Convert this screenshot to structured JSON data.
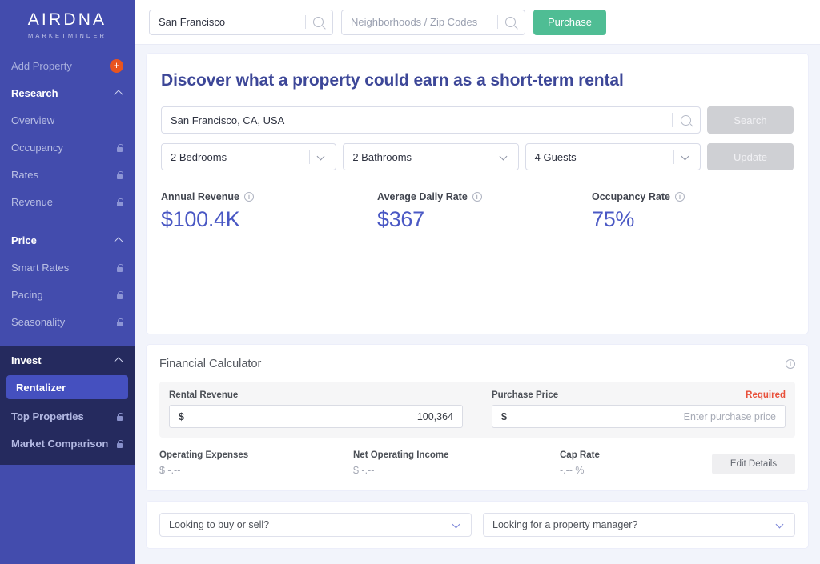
{
  "sidebar": {
    "logo_main": "AIRDNA",
    "logo_sub": "MARKETMINDER",
    "add_property": "Add Property",
    "plus": "+",
    "sections": {
      "research": "Research",
      "price": "Price",
      "invest": "Invest"
    },
    "research_items": [
      {
        "label": "Overview",
        "locked": false
      },
      {
        "label": "Occupancy",
        "locked": true
      },
      {
        "label": "Rates",
        "locked": true
      },
      {
        "label": "Revenue",
        "locked": true
      }
    ],
    "price_items": [
      {
        "label": "Smart Rates",
        "locked": true
      },
      {
        "label": "Pacing",
        "locked": true
      },
      {
        "label": "Seasonality",
        "locked": true
      }
    ],
    "invest_items": [
      {
        "label": "Rentalizer",
        "locked": false,
        "active": true
      },
      {
        "label": "Top Properties",
        "locked": true
      },
      {
        "label": "Market Comparison",
        "locked": true
      }
    ],
    "colors": {
      "background": "#434cad",
      "invest_panel": "#252a5e",
      "active_item": "#4550bf",
      "add_property_button": "#e8541f"
    }
  },
  "topbar": {
    "city_value": "San Francisco",
    "neighborhood_placeholder": "Neighborhoods / Zip Codes",
    "purchase_label": "Purchase",
    "purchase_color": "#4fbd94",
    "search_icon": "search-icon"
  },
  "hero": {
    "title": "Discover what a property could earn as a short-term rental",
    "location_value": "San Francisco, CA, USA",
    "search_label": "Search",
    "update_label": "Update",
    "bedrooms": "2 Bedrooms",
    "bathrooms": "2 Bathrooms",
    "guests": "4 Guests",
    "metrics": [
      {
        "label": "Annual Revenue",
        "value": "$100.4K"
      },
      {
        "label": "Average Daily Rate",
        "value": "$367"
      },
      {
        "label": "Occupancy Rate",
        "value": "75%"
      }
    ],
    "metric_color": "#4a58c4",
    "title_color": "#3d4798"
  },
  "calculator": {
    "title": "Financial Calculator",
    "rental_revenue_label": "Rental Revenue",
    "rental_revenue_value": "100,364",
    "purchase_price_label": "Purchase Price",
    "purchase_price_placeholder": "Enter purchase price",
    "required_label": "Required",
    "required_color": "#e8503a",
    "currency_symbol": "$",
    "stats": [
      {
        "label": "Operating Expenses",
        "value": "$ -.--"
      },
      {
        "label": "Net Operating Income",
        "value": "$ -.--"
      },
      {
        "label": "Cap Rate",
        "value": "-.-- %"
      }
    ],
    "edit_details_label": "Edit Details"
  },
  "footer": {
    "buy_sell_placeholder": "Looking to buy or sell?",
    "property_manager_placeholder": "Looking for a property manager?"
  }
}
